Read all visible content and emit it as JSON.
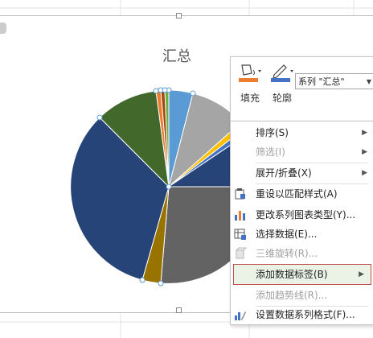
{
  "chart": {
    "title": "汇总"
  },
  "mini_toolbar": {
    "fill_label": "填充",
    "outline_label": "轮廓",
    "series_value": "系列 \"汇总\""
  },
  "context_menu": {
    "items": [
      {
        "label": "排序(S)",
        "submenu": "▶"
      },
      {
        "label": "筛选(I)",
        "submenu": "▶"
      },
      {
        "label": "展开/折叠(X)",
        "submenu": "▶"
      },
      {
        "label": "重设以匹配样式(A)"
      },
      {
        "label": "更改系列图表类型(Y)..."
      },
      {
        "label": "选择数据(E)..."
      },
      {
        "label": "三维旋转(R)..."
      },
      {
        "label": "添加数据标签(B)",
        "submenu": "▶"
      },
      {
        "label": "添加趋势线(R)..."
      },
      {
        "label": "设置数据系列格式(F)..."
      }
    ]
  },
  "colors": {
    "accent_fill": "#ed7d31",
    "accent_outline": "#4472c4",
    "highlight_border": "#c05050",
    "highlight_bg": "#eaf3e6"
  },
  "icons": [
    "fill-bucket-icon",
    "pen-outline-icon",
    "reset-style-icon",
    "chart-type-icon",
    "select-data-icon",
    "rotate-3d-icon",
    "format-series-icon"
  ]
}
